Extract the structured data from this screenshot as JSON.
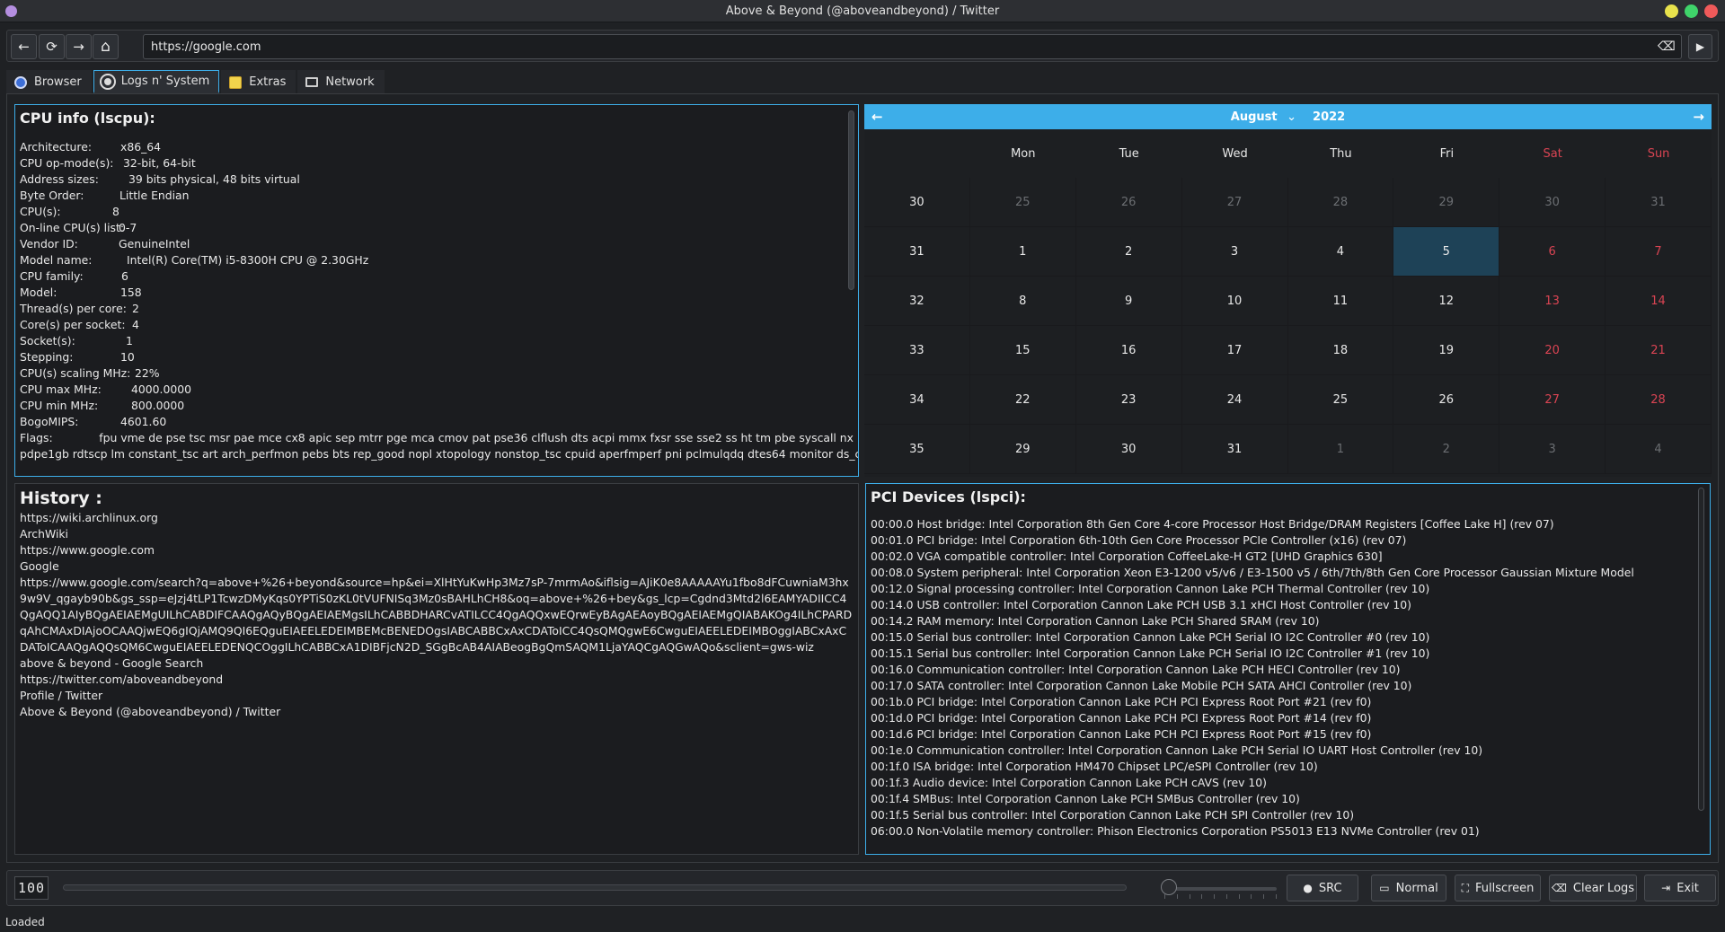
{
  "window": {
    "title": "Above & Beyond (@aboveandbeyond) / Twitter",
    "controls": {
      "minimize_color": "#e8e24c",
      "maximize_color": "#3fd36a",
      "close_color": "#f05a5a"
    }
  },
  "nav": {
    "url": "https://google.com",
    "back_icon": "←",
    "reload_icon": "⟳",
    "forward_icon": "→",
    "home_icon": "⌂",
    "clear_icon": "⌫",
    "go_icon": "▶"
  },
  "tabs": [
    {
      "label": "Browser",
      "icon": "globe-icon",
      "active": false
    },
    {
      "label": "Logs n' System",
      "icon": "gear-icon",
      "active": true
    },
    {
      "label": "Extras",
      "icon": "notes-icon",
      "active": false
    },
    {
      "label": "Network",
      "icon": "monitor-icon",
      "active": false
    }
  ],
  "cpu_info": {
    "title": "CPU info (lscpu):",
    "rows": [
      {
        "key": "Architecture:",
        "value": "x86_64"
      },
      {
        "key": "CPU op-mode(s):",
        "value": "32-bit, 64-bit"
      },
      {
        "key": "Address sizes:",
        "value": "39 bits physical, 48 bits virtual"
      },
      {
        "key": "Byte Order:",
        "value": "Little Endian"
      },
      {
        "key": "CPU(s):",
        "value": "8"
      },
      {
        "key": "On-line CPU(s) list:",
        "value": "0-7"
      },
      {
        "key": "Vendor ID:",
        "value": "GenuineIntel"
      },
      {
        "key": "Model name:",
        "value": "Intel(R) Core(TM) i5-8300H CPU @ 2.30GHz"
      },
      {
        "key": "CPU family:",
        "value": "6"
      },
      {
        "key": "Model:",
        "value": "158"
      },
      {
        "key": "Thread(s) per core:",
        "value": "2"
      },
      {
        "key": "Core(s) per socket:",
        "value": "4"
      },
      {
        "key": "Socket(s):",
        "value": "1"
      },
      {
        "key": "Stepping:",
        "value": "10"
      },
      {
        "key": "CPU(s) scaling MHz:",
        "value": "22%"
      },
      {
        "key": "CPU max MHz:",
        "value": "4000.0000"
      },
      {
        "key": "CPU min MHz:",
        "value": "800.0000"
      },
      {
        "key": "BogoMIPS:",
        "value": "4601.60"
      },
      {
        "key": "Flags:",
        "value": "fpu vme de pse tsc msr pae mce cx8 apic sep mtrr pge mca cmov pat pse36 clflush dts acpi mmx fxsr sse sse2 ss ht tm pbe syscall nx"
      }
    ],
    "flags_continued": "pdpe1gb rdtscp lm constant_tsc art arch_perfmon pebs bts rep_good nopl xtopology nonstop_tsc cpuid aperfmperf pni pclmulqdq dtes64 monitor ds_cpl vmx"
  },
  "calendar": {
    "month": "August",
    "year": "2022",
    "prev_icon": "←",
    "next_icon": "→",
    "dropdown_icon": "⌄",
    "weekdays": [
      "Mon",
      "Tue",
      "Wed",
      "Thu",
      "Fri",
      "Sat",
      "Sun"
    ],
    "weeks": [
      {
        "week": "30",
        "days": [
          "25",
          "26",
          "27",
          "28",
          "29",
          "30",
          "31"
        ]
      },
      {
        "week": "31",
        "days": [
          "1",
          "2",
          "3",
          "4",
          "5",
          "6",
          "7"
        ]
      },
      {
        "week": "32",
        "days": [
          "8",
          "9",
          "10",
          "11",
          "12",
          "13",
          "14"
        ]
      },
      {
        "week": "33",
        "days": [
          "15",
          "16",
          "17",
          "18",
          "19",
          "20",
          "21"
        ]
      },
      {
        "week": "34",
        "days": [
          "22",
          "23",
          "24",
          "25",
          "26",
          "27",
          "28"
        ]
      },
      {
        "week": "35",
        "days": [
          "29",
          "30",
          "31",
          "1",
          "2",
          "3",
          "4"
        ]
      }
    ],
    "selected": "5"
  },
  "history": {
    "title": "History :",
    "lines": [
      "https://wiki.archlinux.org",
      "ArchWiki",
      "https://www.google.com",
      "Google",
      "https://www.google.com/search?q=above+%26+beyond&source=hp&ei=XlHtYuKwHp3Mz7sP-7mrmAo&iflsig=AJiK0e8AAAAAYu1fbo8dFCuwniaM3hx9w9V_qgayb90b&gs_ssp=eJzj4tLP1TcwzDMyKqs0YPTiS0zKL0tVUFNISq3Mz0sBAHLhCH8&oq=above+%26+bey&gs_lcp=Cgdnd3Mtd2l6EAMYADIICC4QgAQQ1AIyBQgAEIAEMgUILhCABDIFCAAQgAQyBQgAEIAEMgsILhCABBDHARCvATILCC4QgAQQxwEQrwEyBAgAEAoyBQgAEIAEMgQIABAKOg4ILhCPARDqAhCMAxDIAjoOCAAQjwEQ6gIQjAMQ9QI6EQguEIAEELEDEIMBEMcBENEDOgsIABCABBCxAxCDAToICC4QsQMQgwE6CwguEIAEELEDEIMBOggIABCxAxCDAToICAAQgAQQsQM6CwguEIAEELEDENQCOggILhCABBCxA1DIBFjcN2D_SGgBcAB4AIABeogBgQmSAQM1LjaYAQCgAQGwAQo&sclient=gws-wiz",
      "above & beyond - Google Search",
      "https://twitter.com/aboveandbeyond",
      "Profile / Twitter",
      "Above & Beyond (@aboveandbeyond) / Twitter"
    ]
  },
  "pci": {
    "title": "PCI Devices (lspci):",
    "lines": [
      "00:00.0 Host bridge: Intel Corporation 8th Gen Core 4-core Processor Host Bridge/DRAM Registers [Coffee Lake H] (rev 07)",
      "00:01.0 PCI bridge: Intel Corporation 6th-10th Gen Core Processor PCIe Controller (x16) (rev 07)",
      "00:02.0 VGA compatible controller: Intel Corporation CoffeeLake-H GT2 [UHD Graphics 630]",
      "00:08.0 System peripheral: Intel Corporation Xeon E3-1200 v5/v6 / E3-1500 v5 / 6th/7th/8th Gen Core Processor Gaussian Mixture Model",
      "00:12.0 Signal processing controller: Intel Corporation Cannon Lake PCH Thermal Controller (rev 10)",
      "00:14.0 USB controller: Intel Corporation Cannon Lake PCH USB 3.1 xHCI Host Controller (rev 10)",
      "00:14.2 RAM memory: Intel Corporation Cannon Lake PCH Shared SRAM (rev 10)",
      "00:15.0 Serial bus controller: Intel Corporation Cannon Lake PCH Serial IO I2C Controller #0 (rev 10)",
      "00:15.1 Serial bus controller: Intel Corporation Cannon Lake PCH Serial IO I2C Controller #1 (rev 10)",
      "00:16.0 Communication controller: Intel Corporation Cannon Lake PCH HECI Controller (rev 10)",
      "00:17.0 SATA controller: Intel Corporation Cannon Lake Mobile PCH SATA AHCI Controller (rev 10)",
      "00:1b.0 PCI bridge: Intel Corporation Cannon Lake PCH PCI Express Root Port #21 (rev f0)",
      "00:1d.0 PCI bridge: Intel Corporation Cannon Lake PCH PCI Express Root Port #14 (rev f0)",
      "00:1d.6 PCI bridge: Intel Corporation Cannon Lake PCH PCI Express Root Port #15 (rev f0)",
      "00:1e.0 Communication controller: Intel Corporation Cannon Lake PCH Serial IO UART Host Controller (rev 10)",
      "00:1f.0 ISA bridge: Intel Corporation HM470 Chipset LPC/eSPI Controller (rev 10)",
      "00:1f.3 Audio device: Intel Corporation Cannon Lake PCH cAVS (rev 10)",
      "00:1f.4 SMBus: Intel Corporation Cannon Lake PCH SMBus Controller (rev 10)",
      "00:1f.5 Serial bus controller: Intel Corporation Cannon Lake PCH SPI Controller (rev 10)",
      "06:00.0 Non-Volatile memory controller: Phison Electronics Corporation PS5013 E13 NVMe Controller (rev 01)"
    ]
  },
  "bottom": {
    "lcd": "100",
    "progress": 0,
    "slider": 0,
    "buttons": [
      {
        "label": "SRC",
        "icon": "github-icon"
      },
      {
        "label": "Normal",
        "icon": "window-icon"
      },
      {
        "label": "Fullscreen",
        "icon": "fullscreen-icon"
      },
      {
        "label": "Clear Logs",
        "icon": "clear-icon"
      },
      {
        "label": "Exit",
        "icon": "exit-icon"
      }
    ]
  },
  "status": "Loaded",
  "colors": {
    "accent": "#3daee9",
    "weekend": "#da4453",
    "selected": "#1e4257"
  }
}
